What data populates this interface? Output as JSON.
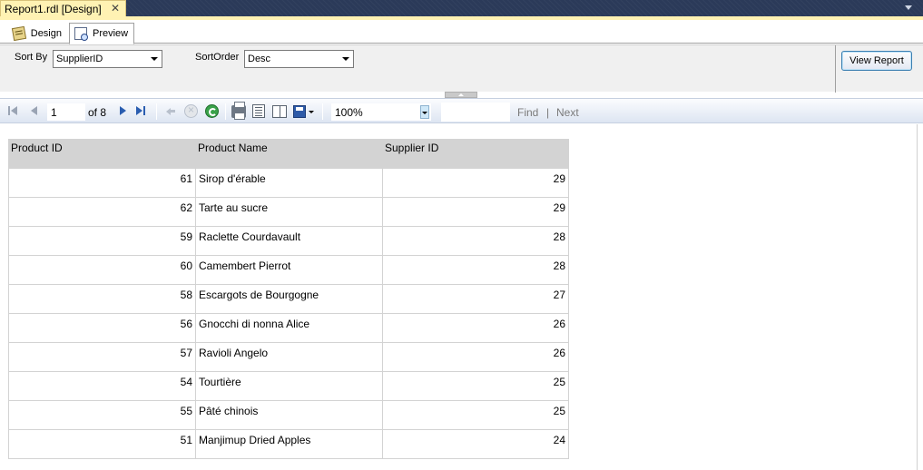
{
  "document_tab": {
    "title": "Report1.rdl [Design]"
  },
  "view_tabs": [
    {
      "label": "Design"
    },
    {
      "label": "Preview"
    }
  ],
  "parameters": {
    "sort_by": {
      "label": "Sort By",
      "value": "SupplierID"
    },
    "sort_order": {
      "label": "SortOrder",
      "value": "Desc"
    },
    "view_report_label": "View Report"
  },
  "toolbar": {
    "current_page": "1",
    "of_label": "of",
    "total_pages": "8",
    "zoom": "100%",
    "find_label": "Find",
    "find_separator": "|",
    "next_label": "Next"
  },
  "report": {
    "columns": [
      "Product ID",
      "Product Name",
      "Supplier ID"
    ],
    "rows": [
      [
        "61",
        "Sirop d'érable",
        "29"
      ],
      [
        "62",
        "Tarte au sucre",
        "29"
      ],
      [
        "59",
        "Raclette Courdavault",
        "28"
      ],
      [
        "60",
        "Camembert Pierrot",
        "28"
      ],
      [
        "58",
        "Escargots de Bourgogne",
        "27"
      ],
      [
        "56",
        "Gnocchi di nonna Alice",
        "26"
      ],
      [
        "57",
        "Ravioli Angelo",
        "26"
      ],
      [
        "54",
        "Tourtière",
        "25"
      ],
      [
        "55",
        "Pâté chinois",
        "25"
      ],
      [
        "51",
        "Manjimup Dried Apples",
        "24"
      ]
    ]
  },
  "colors": {
    "header_fill": "#d3d3d3",
    "tab_highlight": "#fff2b3",
    "ide_background": "#2b3a59"
  }
}
